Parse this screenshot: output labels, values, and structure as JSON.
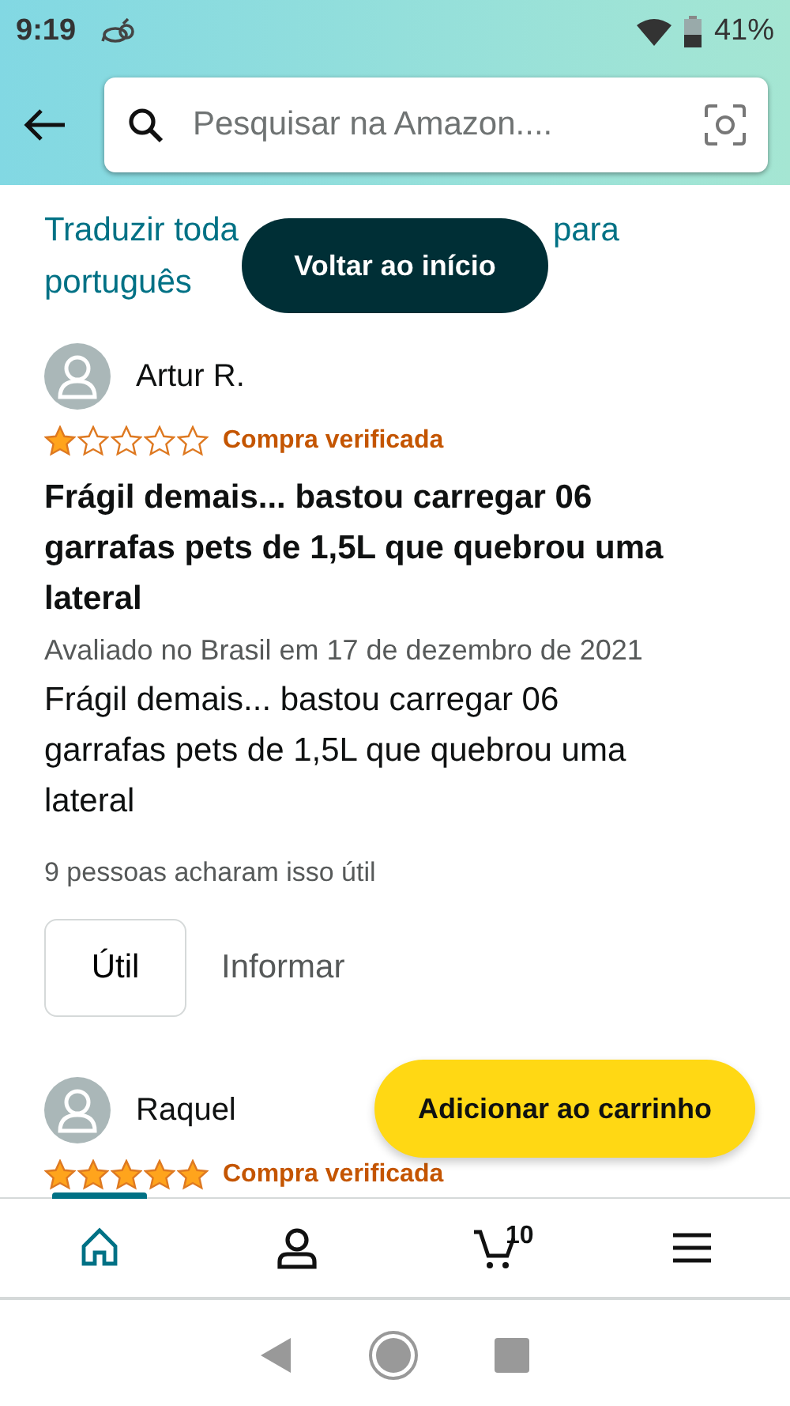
{
  "status_bar": {
    "time": "9:19",
    "battery": "41%"
  },
  "header": {
    "search": {
      "placeholder": "Pesquisar na Amazon...."
    }
  },
  "translate_link": {
    "parts": [
      "Traduzir toda",
      "para",
      "português"
    ]
  },
  "back_to_top": "Voltar ao início",
  "reviews": [
    {
      "author": "Artur R.",
      "stars": 1,
      "badge": "Compra verificada",
      "title": "Frágil demais... bastou carregar 06 garrafas pets de 1,5L que quebrou uma lateral",
      "date": "Avaliado no Brasil em 17 de dezembro de 2021",
      "body": "Frágil demais... bastou carregar 06 garrafas pets de 1,5L que quebrou uma lateral",
      "helpful": "9 pessoas acharam isso útil",
      "buttons": [
        "Útil",
        "Informar"
      ]
    },
    {
      "author": "Raquel",
      "stars": 5,
      "badge": "Compra verificada"
    }
  ],
  "add_to_cart": "Adicionar ao carrinho",
  "bottom_nav": [
    {
      "kind": "home",
      "selected": true
    },
    {
      "kind": "account",
      "selected": false
    },
    {
      "kind": "cart",
      "badge": "10",
      "selected": false
    },
    {
      "kind": "menu",
      "selected": false
    }
  ]
}
